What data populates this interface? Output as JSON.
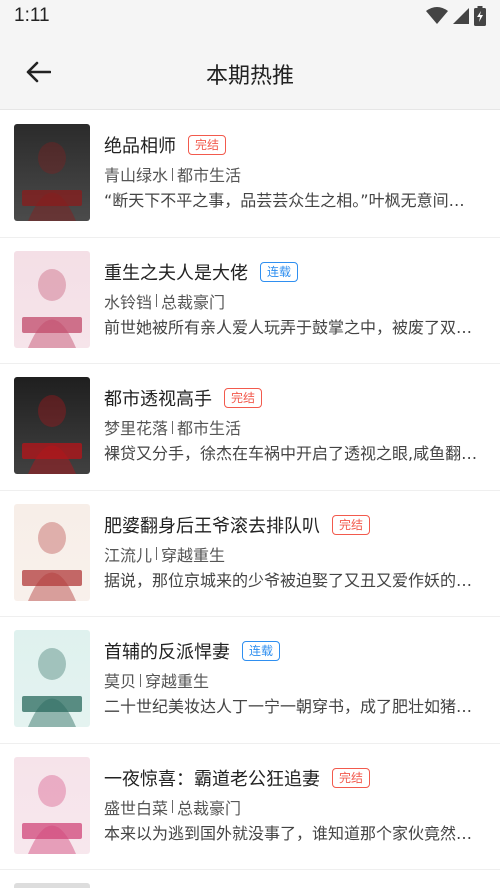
{
  "status_bar": {
    "time": "1:11"
  },
  "app_bar": {
    "title": "本期热推"
  },
  "books": [
    {
      "title": "绝品相师",
      "status": "完结",
      "status_type": "done",
      "author": "青山绿水",
      "category": "都市生活",
      "desc": "“断天下不平之事，品芸芸众生之相。”叶枫无意间…",
      "cover_colors": [
        "#2b2b2b",
        "#8a1c1c"
      ]
    },
    {
      "title": "重生之夫人是大佬",
      "status": "连载",
      "status_type": "serial",
      "author": "水铃铛",
      "category": "总裁豪门",
      "desc": "前世她被所有亲人爱人玩弄于鼓掌之中，被废了双…",
      "cover_colors": [
        "#f4dfe6",
        "#c04a6a"
      ]
    },
    {
      "title": "都市透视高手",
      "status": "完结",
      "status_type": "done",
      "author": "梦里花落",
      "category": "都市生活",
      "desc": "裸贷又分手，徐杰在车祸中开启了透视之眼,咸鱼翻…",
      "cover_colors": [
        "#1f1f1f",
        "#b8141a"
      ]
    },
    {
      "title": "肥婆翻身后王爷滚去排队叭",
      "status": "完结",
      "status_type": "done",
      "author": "江流儿",
      "category": "穿越重生",
      "desc": "据说，那位京城来的少爷被迫娶了又丑又爱作妖的…",
      "cover_colors": [
        "#f7eee8",
        "#b23a3a"
      ]
    },
    {
      "title": "首辅的反派悍妻",
      "status": "连载",
      "status_type": "serial",
      "author": "莫贝",
      "category": "穿越重生",
      "desc": "二十世纪美妆达人丁一宁一朝穿书，成了肥壮如猪…",
      "cover_colors": [
        "#dff1ee",
        "#2a6a5e"
      ]
    },
    {
      "title": "一夜惊喜：霸道老公狂追妻",
      "status": "完结",
      "status_type": "done",
      "author": "盛世白菜",
      "category": "总裁豪门",
      "desc": "本来以为逃到国外就没事了，谁知道那个家伙竟然…",
      "cover_colors": [
        "#f6e3ea",
        "#d0457a"
      ]
    }
  ]
}
